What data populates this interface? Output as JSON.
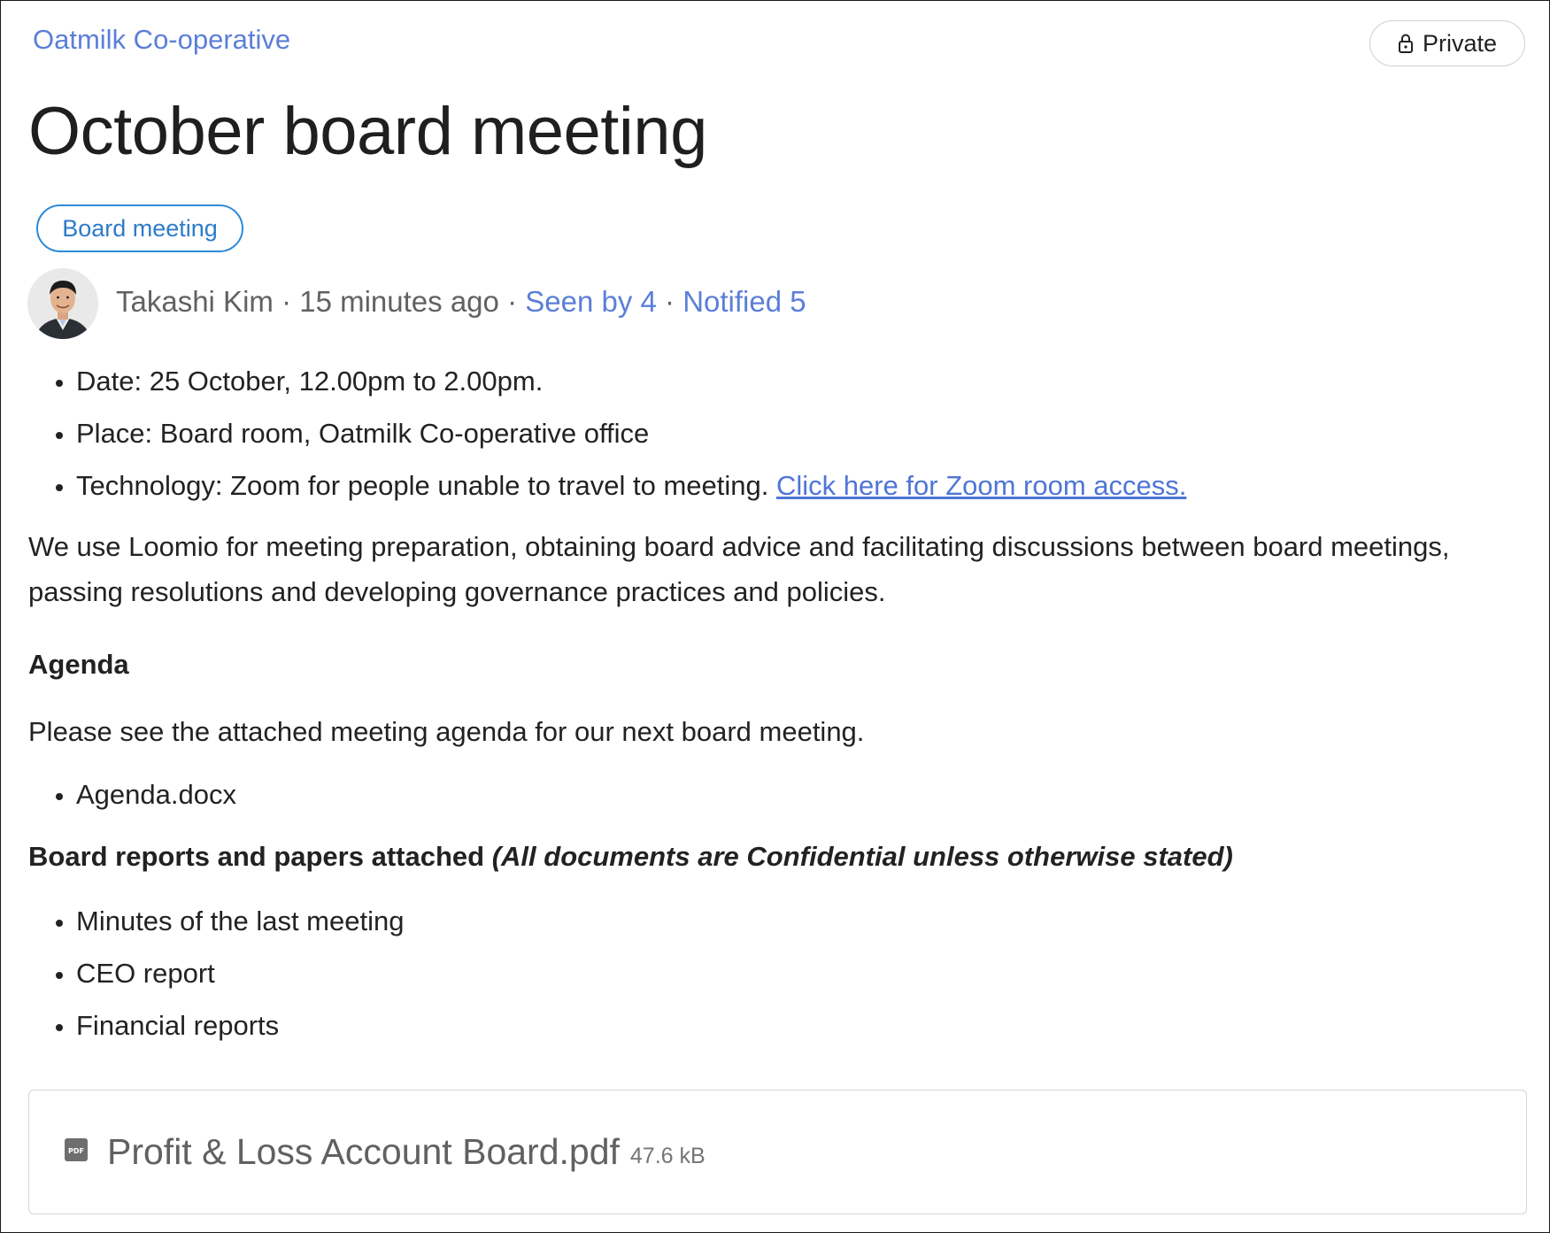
{
  "header": {
    "group_name": "Oatmilk Co-operative",
    "privacy_label": "Private",
    "privacy_icon": "lock-icon"
  },
  "thread": {
    "title": "October board meeting",
    "tag": "Board meeting",
    "author": "Takashi Kim",
    "separator": "·",
    "time_ago": "15 minutes ago",
    "seen_by": "Seen by 4",
    "notified": "Notified 5"
  },
  "body": {
    "details": [
      {
        "text": "Date: 25 October, 12.00pm to 2.00pm."
      },
      {
        "text": "Place: Board room, Oatmilk Co-operative office"
      },
      {
        "text": "Technology: Zoom for people unable to travel to meeting. ",
        "link": "Click here for Zoom room access."
      }
    ],
    "intro": "We use Loomio for meeting preparation, obtaining board advice and facilitating discussions between board meetings, passing resolutions and developing governance practices and policies.",
    "agenda_heading": "Agenda",
    "agenda_text": "Please see the attached meeting agenda for our next board meeting.",
    "agenda_items": [
      "Agenda.docx"
    ],
    "reports_heading": "Board reports and papers attached",
    "reports_note": "(All documents are Confidential unless otherwise stated)",
    "reports_items": [
      "Minutes of the last meeting",
      "CEO report",
      "Financial reports"
    ]
  },
  "attachment": {
    "icon": "pdf-icon",
    "icon_label": "PDF",
    "file_name": "Profit & Loss Account Board.pdf",
    "file_size": "47.6 kB"
  }
}
